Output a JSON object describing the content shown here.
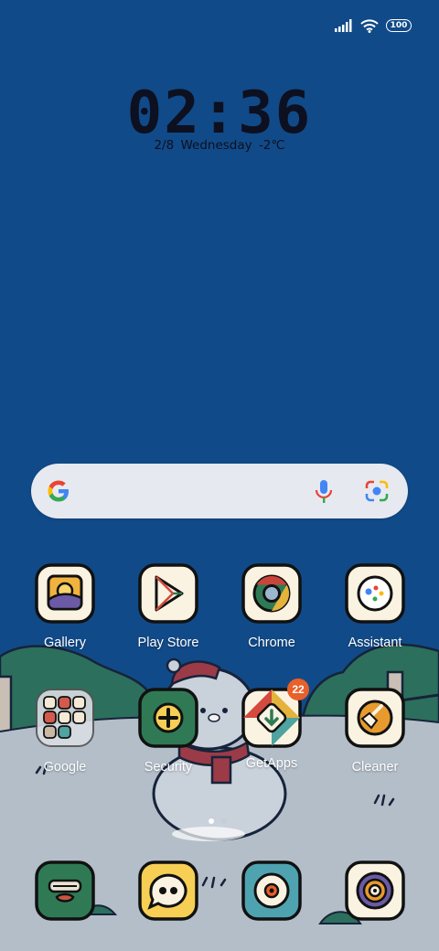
{
  "status_bar": {
    "signal_icon": "signal-icon",
    "wifi_icon": "wifi-icon",
    "battery": "100"
  },
  "lockscreen_widget": {
    "time": "02:36",
    "date": "2/8",
    "weekday": "Wednesday",
    "temperature": "-2℃"
  },
  "search_bar": {
    "google_icon": "google-g-icon",
    "mic_icon": "microphone-icon",
    "lens_icon": "lens-camera-icon"
  },
  "apps_row1": [
    {
      "label": "Gallery",
      "icon": "gallery-icon"
    },
    {
      "label": "Play Store",
      "icon": "play-store-icon"
    },
    {
      "label": "Chrome",
      "icon": "chrome-icon"
    },
    {
      "label": "Assistant",
      "icon": "assistant-icon"
    }
  ],
  "apps_row2": [
    {
      "label": "Google",
      "icon": "google-folder-icon"
    },
    {
      "label": "Security",
      "icon": "security-icon"
    },
    {
      "label": "GetApps",
      "icon": "getapps-icon",
      "badge": "22"
    },
    {
      "label": "Cleaner",
      "icon": "cleaner-icon"
    }
  ],
  "dock": [
    {
      "icon": "contacts-icon"
    },
    {
      "icon": "messages-icon"
    },
    {
      "icon": "camera-icon"
    },
    {
      "icon": "music-icon"
    }
  ],
  "page_indicator": {
    "pages": 2,
    "current": 1
  },
  "colors": {
    "sky": "#114a88",
    "ground": "#b3bec9",
    "hills": "#2c6f5c",
    "icon_bg": "#fbf3e1",
    "icon_outline": "#111111",
    "badge": "#e8602a"
  }
}
